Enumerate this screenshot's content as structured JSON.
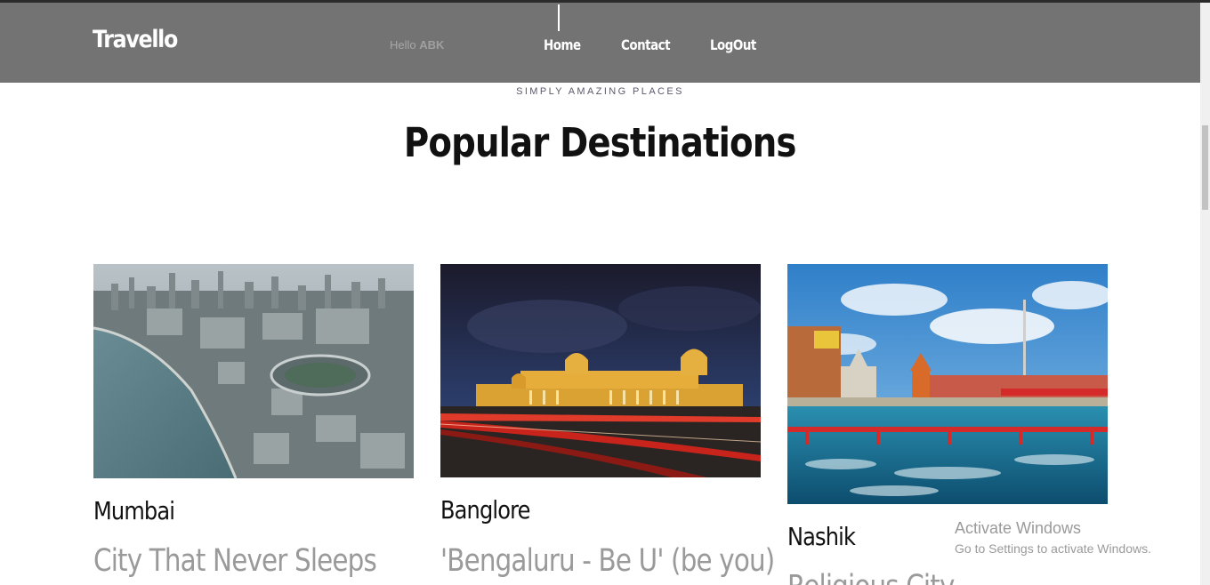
{
  "navbar": {
    "brand": "Travello",
    "greeting": "Hello",
    "username": "ABK",
    "links": [
      "Home",
      "Contact",
      "LogOut"
    ]
  },
  "section": {
    "subtitle": "SIMPLY AMAZING PLACES",
    "title": "Popular Destinations"
  },
  "destinations": [
    {
      "name": "Mumbai",
      "description": "City That Never Sleeps",
      "image": "mumbai-skyline-photo"
    },
    {
      "name": "Banglore",
      "description": "'Bengaluru - Be U' (be you)",
      "image": "vidhana-soudha-night-photo"
    },
    {
      "name": "Nashik",
      "description": "Religious City",
      "image": "nashik-ghats-photo"
    }
  ],
  "watermark": {
    "title": "Activate Windows",
    "subtitle": "Go to Settings to activate Windows."
  }
}
